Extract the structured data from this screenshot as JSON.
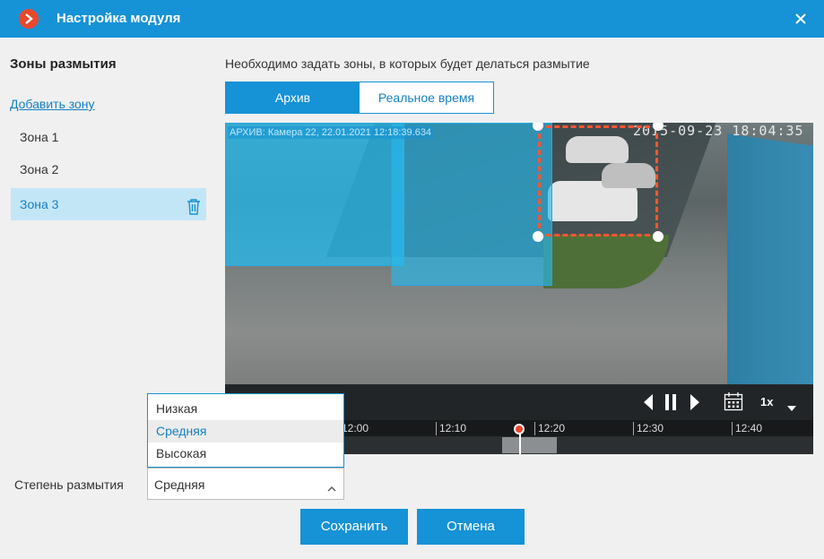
{
  "window": {
    "title": "Настройка модуля"
  },
  "sidebar": {
    "title": "Зоны размытия",
    "add_zone": "Добавить зону",
    "zones": [
      {
        "label": "Зона 1"
      },
      {
        "label": "Зона 2"
      },
      {
        "label": "Зона 3",
        "selected": true
      }
    ]
  },
  "main": {
    "instruction": "Необходимо задать зоны, в которых будет делаться размытие",
    "tabs": [
      {
        "label": "Архив",
        "active": true
      },
      {
        "label": "Реальное время",
        "active": false
      }
    ],
    "video": {
      "osd": "АРХИВ: Камера 22, 22.01.2021 12:18:39.634",
      "camera_time": "2015-09-23 18:04:35"
    },
    "player": {
      "speed": "1x",
      "timeline_labels": [
        "12:00",
        "12:10",
        "12:20",
        "12:30",
        "12:40"
      ]
    }
  },
  "blur": {
    "label": "Степень размытия",
    "value": "Средняя",
    "options": [
      "Низкая",
      "Средняя",
      "Высокая"
    ],
    "selected_index": 1
  },
  "buttons": {
    "save": "Сохранить",
    "cancel": "Отмена"
  },
  "colors": {
    "accent": "#1692d6",
    "logo": "#e8482c",
    "selection_border": "#ff5533",
    "blur_zone": "#28b9eb"
  }
}
